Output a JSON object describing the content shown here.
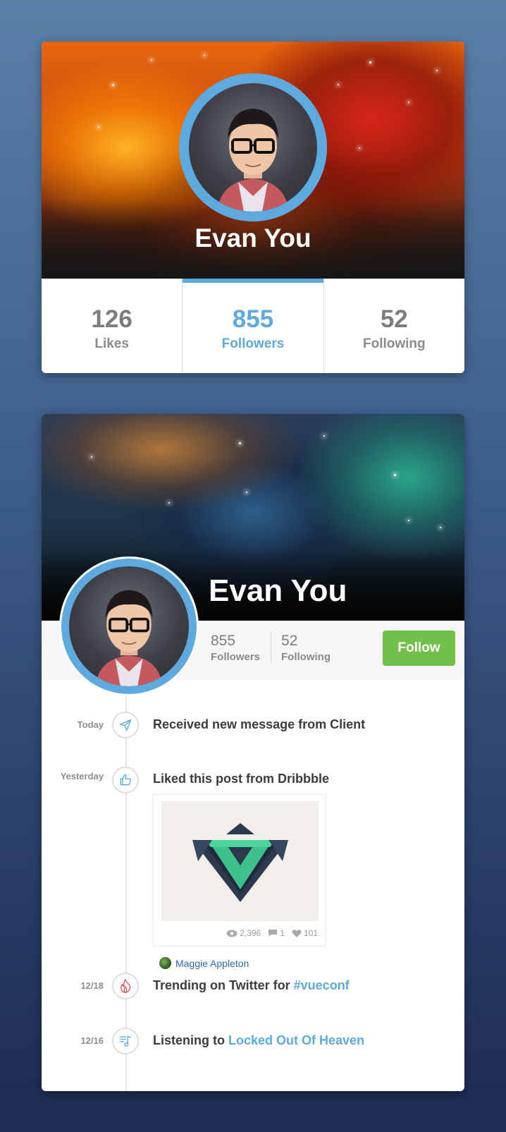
{
  "card1": {
    "name": "Evan You",
    "stats": [
      {
        "value": "126",
        "label": "Likes",
        "active": false
      },
      {
        "value": "855",
        "label": "Followers",
        "active": true
      },
      {
        "value": "52",
        "label": "Following",
        "active": false
      }
    ]
  },
  "card2": {
    "name": "Evan You",
    "followers_value": "855",
    "followers_label": "Followers",
    "following_value": "52",
    "following_label": "Following",
    "follow_button": "Follow",
    "timeline": [
      {
        "date": "Today",
        "icon": "paper-plane-icon",
        "text": "Received new message from Client"
      },
      {
        "date": "Yesterday",
        "icon": "thumbs-up-icon",
        "text": "Liked this post from Dribbble"
      },
      {
        "date": "12/18",
        "icon": "flame-icon",
        "text": "Trending on Twitter for ",
        "link": "#vueconf"
      },
      {
        "date": "12/16",
        "icon": "music-note-icon",
        "text": "Listening to ",
        "link": "Locked Out Of Heaven"
      }
    ],
    "shot": {
      "views": "2,396",
      "comments": "1",
      "likes": "101",
      "author": "Maggie Appleton"
    }
  },
  "colors": {
    "accent": "#5ea9de",
    "follow": "#72c04a",
    "background_top": "#5b80a8",
    "background_bottom": "#1e2b52"
  }
}
